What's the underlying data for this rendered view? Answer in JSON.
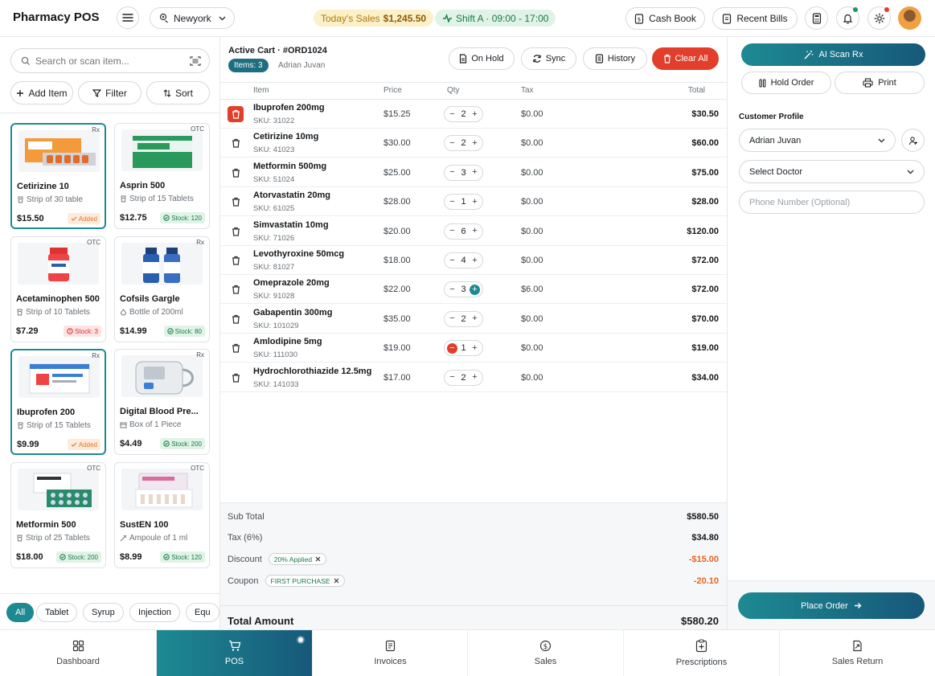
{
  "app": {
    "title": "Pharmacy POS"
  },
  "topbar": {
    "location": "Newyork",
    "sales_label": "Today's Sales",
    "sales_value": "$1,245.50",
    "shift": "Shift A · 09:00 - 17:00",
    "cash_book": "Cash Book",
    "recent_bills": "Recent Bills"
  },
  "left": {
    "search_placeholder": "Search or scan item...",
    "add_item": "Add Item",
    "filter": "Filter",
    "sort": "Sort",
    "products": [
      {
        "name": "Cetirizine 10",
        "pack": "Strip of 30 table",
        "price": "$15.50",
        "tag": "Rx",
        "badge": "Added",
        "badge_type": "added",
        "selected": true
      },
      {
        "name": "Asprin 500",
        "pack": "Strip of 15 Tablets",
        "price": "$12.75",
        "tag": "OTC",
        "badge": "Stock: 120",
        "badge_type": "stock",
        "selected": false
      },
      {
        "name": "Acetaminophen 500",
        "pack": "Strip of 10 Tablets",
        "price": "$7.29",
        "tag": "OTC",
        "badge": "Stock: 3",
        "badge_type": "low",
        "selected": false
      },
      {
        "name": "Cofsils Gargle",
        "pack": "Bottle of 200ml",
        "price": "$14.99",
        "tag": "Rx",
        "badge": "Stock: 80",
        "badge_type": "stock",
        "selected": false
      },
      {
        "name": "Ibuprofen 200",
        "pack": "Strip of 15 Tablets",
        "price": "$9.99",
        "tag": "Rx",
        "badge": "Added",
        "badge_type": "added",
        "selected": true
      },
      {
        "name": "Digital Blood Pre...",
        "pack": "Box of 1 Piece",
        "price": "$4.49",
        "tag": "Rx",
        "badge": "Stock: 200",
        "badge_type": "stock",
        "selected": false
      },
      {
        "name": "Metformin 500",
        "pack": "Strip of 25 Tablets",
        "price": "$18.00",
        "tag": "OTC",
        "badge": "Stock: 200",
        "badge_type": "stock",
        "selected": false
      },
      {
        "name": "SustEN 100",
        "pack": "Ampoule of 1 ml",
        "price": "$8.99",
        "tag": "OTC",
        "badge": "Stock: 120",
        "badge_type": "stock",
        "selected": false
      }
    ],
    "categories": [
      "All",
      "Tablet",
      "Syrup",
      "Injection",
      "Equ"
    ]
  },
  "cart": {
    "title": "Active Cart · #ORD1024",
    "items_count": "Items: 3",
    "customer": "Adrian Juvan",
    "on_hold": "On Hold",
    "sync": "Sync",
    "history": "History",
    "clear_all": "Clear All",
    "columns": {
      "item": "Item",
      "price": "Price",
      "qty": "Qty",
      "tax": "Tax",
      "total": "Total"
    },
    "rows": [
      {
        "name": "Ibuprofen 200mg",
        "sku": "SKU: 31022",
        "price": "$15.25",
        "qty": "2",
        "tax": "$0.00",
        "total": "$30.50"
      },
      {
        "name": "Cetirizine 10mg",
        "sku": "SKU: 41023",
        "price": "$30.00",
        "qty": "2",
        "tax": "$0.00",
        "total": "$60.00"
      },
      {
        "name": "Metformin 500mg",
        "sku": "SKU: 51024",
        "price": "$25.00",
        "qty": "3",
        "tax": "$0.00",
        "total": "$75.00"
      },
      {
        "name": "Atorvastatin 20mg",
        "sku": "SKU: 61025",
        "price": "$28.00",
        "qty": "1",
        "tax": "$0.00",
        "total": "$28.00"
      },
      {
        "name": "Simvastatin 10mg",
        "sku": "SKU: 71026",
        "price": "$20.00",
        "qty": "6",
        "tax": "$0.00",
        "total": "$120.00"
      },
      {
        "name": "Levothyroxine 50mcg",
        "sku": "SKU: 81027",
        "price": "$18.00",
        "qty": "4",
        "tax": "$0.00",
        "total": "$72.00"
      },
      {
        "name": "Omeprazole 20mg",
        "sku": "SKU: 91028",
        "price": "$22.00",
        "qty": "3",
        "tax": "$6.00",
        "total": "$72.00"
      },
      {
        "name": "Gabapentin 300mg",
        "sku": "SKU: 101029",
        "price": "$35.00",
        "qty": "2",
        "tax": "$0.00",
        "total": "$70.00"
      },
      {
        "name": "Amlodipine 5mg",
        "sku": "SKU: 111030",
        "price": "$19.00",
        "qty": "1",
        "tax": "$0.00",
        "total": "$19.00"
      },
      {
        "name": "Hydrochlorothiazide 12.5mg",
        "sku": "SKU: 141033",
        "price": "$17.00",
        "qty": "2",
        "tax": "$0.00",
        "total": "$34.00"
      }
    ],
    "summary": {
      "subtotal_label": "Sub Total",
      "subtotal": "$580.50",
      "tax_label": "Tax (6%)",
      "tax": "$34.80",
      "discount_label": "Discount",
      "discount_tag": "20% Applied",
      "discount": "-$15.00",
      "coupon_label": "Coupon",
      "coupon_tag": "FIRST PURCHASE",
      "coupon": "-20.10",
      "total_label": "Total Amount",
      "total": "$580.20"
    }
  },
  "right": {
    "ai_scan": "AI Scan Rx",
    "hold_order": "Hold Order",
    "print": "Print",
    "customer_profile": "Customer Profile",
    "customer": "Adrian Juvan",
    "doctor_placeholder": "Select Doctor",
    "phone_placeholder": "Phone Number (Optional)",
    "place_order": "Place Order"
  },
  "nav": [
    {
      "label": "Dashboard"
    },
    {
      "label": "POS"
    },
    {
      "label": "Invoices"
    },
    {
      "label": "Sales"
    },
    {
      "label": "Prescriptions"
    },
    {
      "label": "Sales Return"
    }
  ],
  "colors": {
    "accent": "#1d8a92",
    "accent_dark": "#17587a",
    "danger": "#e23e2b",
    "warning": "#e8661f"
  }
}
